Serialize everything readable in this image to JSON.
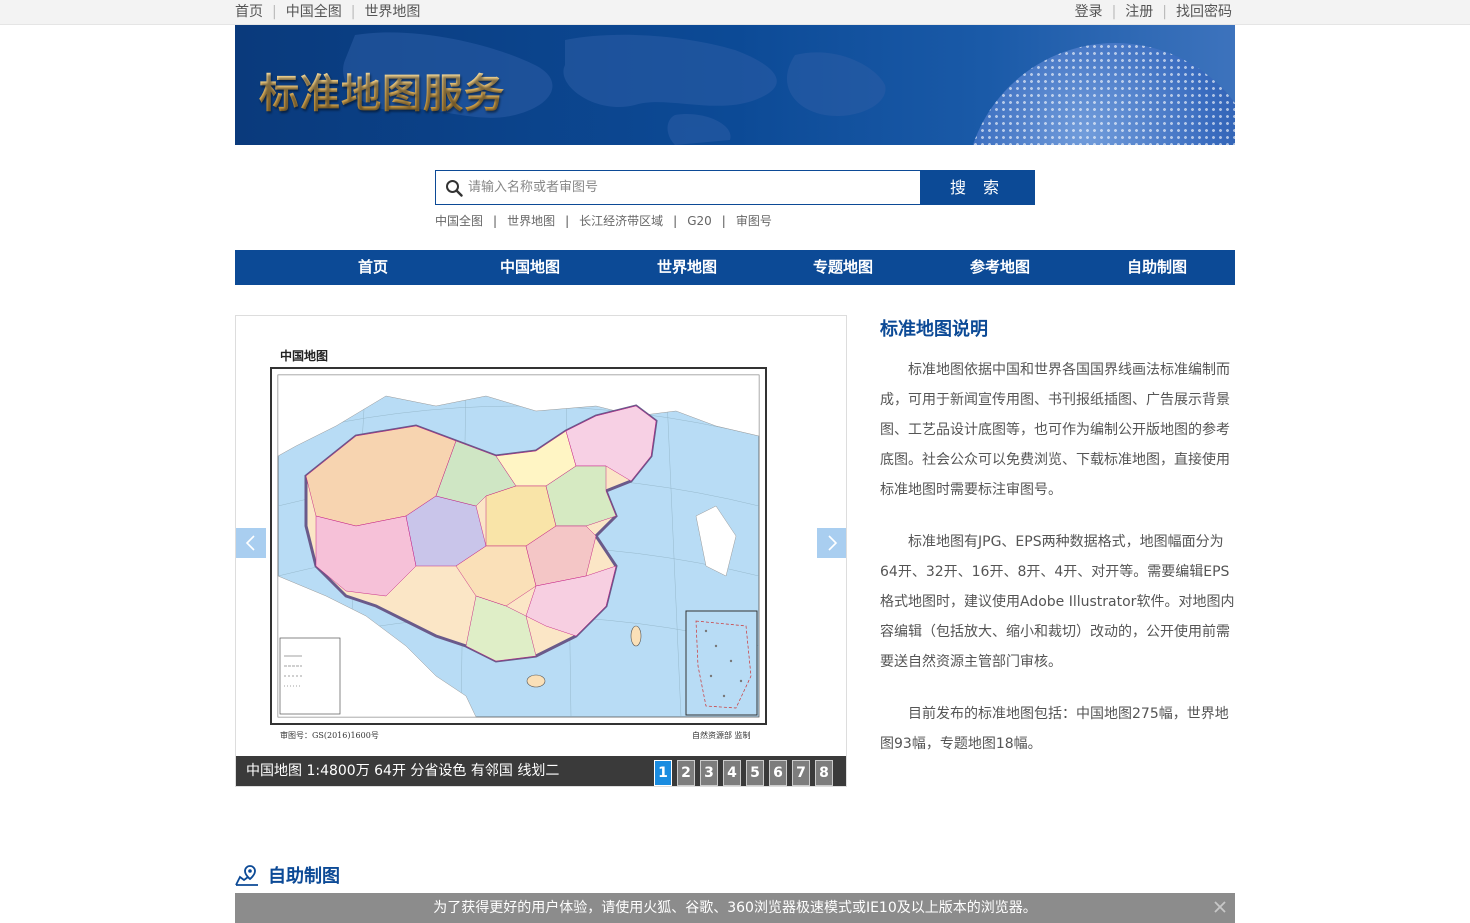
{
  "topbar": {
    "links_left": [
      "首页",
      "中国全图",
      "世界地图"
    ],
    "links_right": [
      "登录",
      "注册",
      "找回密码"
    ],
    "separator": "|"
  },
  "banner": {
    "title": "标准地图服务"
  },
  "search": {
    "placeholder": "请输入名称或者审图号",
    "button": "搜 索",
    "icon": "search-icon",
    "quick_links": [
      "中国全图",
      "世界地图",
      "长江经济带区域",
      "G20",
      "审图号"
    ]
  },
  "nav": [
    "首页",
    "中国地图",
    "世界地图",
    "专题地图",
    "参考地图",
    "自助制图"
  ],
  "slider": {
    "map_title": "中国地图",
    "map_code": "审图号：GS(2016)1600号",
    "map_publisher": "自然资源部 监制",
    "caption": "中国地图 1:4800万 64开 分省设色 有邻国 线划二",
    "pages": [
      "1",
      "2",
      "3",
      "4",
      "5",
      "6",
      "7",
      "8"
    ],
    "active_page": 1
  },
  "description": {
    "title": "标准地图说明",
    "paragraphs": [
      "标准地图依据中国和世界各国国界线画法标准编制而成，可用于新闻宣传用图、书刊报纸插图、广告展示背景图、工艺品设计底图等，也可作为编制公开版地图的参考底图。社会公众可以免费浏览、下载标准地图，直接使用标准地图时需要标注审图号。",
      "标准地图有JPG、EPS两种数据格式，地图幅面分为64开、32开、16开、8开、4开、对开等。需要编辑EPS格式地图时，建议使用Adobe Illustrator软件。对地图内容编辑（包括放大、缩小和裁切）改动的，公开使用前需要送自然资源主管部门审核。",
      "目前发布的标准地图包括：中国地图275幅，世界地图93幅，专题地图18幅。"
    ]
  },
  "section": {
    "title": "自助制图",
    "icon": "map-pin-icon"
  },
  "notice": {
    "text": "为了获得更好的用户体验，请使用火狐、谷歌、360浏览器极速模式或IE10及以上版本的浏览器。"
  },
  "colors": {
    "brand": "#0c4a96",
    "accent": "#1a8ce0",
    "notice_bg": "#8c8c8c"
  }
}
